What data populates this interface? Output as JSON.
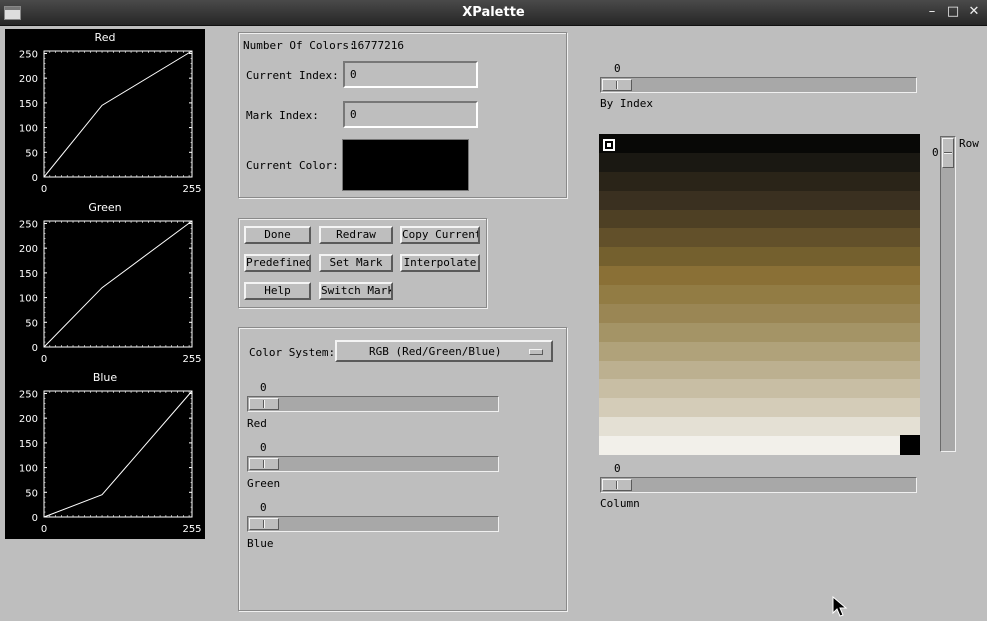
{
  "window": {
    "title": "XPalette"
  },
  "plots": [
    {
      "title": "Red",
      "y_ticks": [
        "250",
        "200",
        "150",
        "100",
        "50",
        "0"
      ],
      "x_ticks": [
        "0",
        "255"
      ],
      "curve": [
        [
          0,
          0
        ],
        [
          100,
          145
        ],
        [
          255,
          255
        ]
      ]
    },
    {
      "title": "Green",
      "y_ticks": [
        "250",
        "200",
        "150",
        "100",
        "50",
        "0"
      ],
      "x_ticks": [
        "0",
        "255"
      ],
      "curve": [
        [
          0,
          0
        ],
        [
          100,
          120
        ],
        [
          255,
          255
        ]
      ]
    },
    {
      "title": "Blue",
      "y_ticks": [
        "250",
        "200",
        "150",
        "100",
        "50",
        "0"
      ],
      "x_ticks": [
        "0",
        "255"
      ],
      "curve": [
        [
          0,
          0
        ],
        [
          100,
          45
        ],
        [
          255,
          255
        ]
      ]
    }
  ],
  "info": {
    "num_colors_label": "Number Of Colors:",
    "num_colors_value": "16777216",
    "current_index_label": "Current Index:",
    "current_index_value": "0",
    "mark_index_label": "Mark Index:",
    "mark_index_value": "0",
    "current_color_label": "Current Color:",
    "current_color": "#000000"
  },
  "buttons": {
    "done": "Done",
    "redraw": "Redraw",
    "copy_current": "Copy Current",
    "predefined": "Predefined",
    "set_mark": "Set Mark",
    "interpolate": "Interpolate",
    "help": "Help",
    "switch_mark": "Switch Mark"
  },
  "color_system": {
    "label": "Color System:",
    "selected": "RGB  (Red/Green/Blue)",
    "sliders": [
      {
        "label": "Red",
        "value": "0"
      },
      {
        "label": "Green",
        "value": "0"
      },
      {
        "label": "Blue",
        "value": "0"
      }
    ]
  },
  "by_index": {
    "label": "By Index",
    "value": "0"
  },
  "row": {
    "label": "Row",
    "value": "0"
  },
  "column": {
    "label": "Column",
    "value": "0"
  },
  "palette_rows": [
    "#080806",
    "#1a1812",
    "#2a2418",
    "#3a3020",
    "#4e4024",
    "#62502a",
    "#74602e",
    "#8a7036",
    "#927c44",
    "#9a8654",
    "#a49466",
    "#b0a27a",
    "#bcb090",
    "#c8bea4",
    "#d4ccb8",
    "#e4e0d4",
    "#f2f0ea"
  ]
}
